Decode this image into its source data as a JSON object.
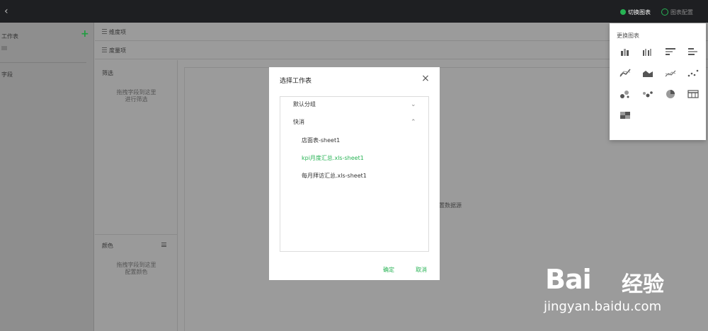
{
  "topbar": {
    "switch_chart_label": "切换图表",
    "chart_config_label": "图表配置"
  },
  "left_panel": {
    "worksheet_title": "工作表",
    "fields_title": "字段"
  },
  "shelves": {
    "dimension_label": "维度项",
    "measure_label": "度量项"
  },
  "filter": {
    "title": "筛选",
    "hint_line1": "拖拽字段到这里",
    "hint_line2": "进行筛选"
  },
  "color": {
    "title": "颜色",
    "hint_line1": "拖拽字段到这里",
    "hint_line2": "配置颜色"
  },
  "canvas": {
    "hint": "配置数据源"
  },
  "popup": {
    "title": "更换图表",
    "chart_types": [
      "grouped-bar-icon",
      "stacked-bar-icon",
      "horizontal-bar-icon",
      "horizontal-stacked-bar-icon",
      "line-icon",
      "area-icon",
      "multi-line-icon",
      "scatter-icon",
      "bubble-icon",
      "dot-icon",
      "pie-icon",
      "table-icon",
      "heatmap-icon"
    ]
  },
  "modal": {
    "title": "选择工作表",
    "groups": [
      {
        "label": "默认分组",
        "expanded": false,
        "items": []
      },
      {
        "label": "快消",
        "expanded": true,
        "items": [
          {
            "label": "店面表-sheet1",
            "active": false
          },
          {
            "label": "kpi月度汇总.xls-sheet1",
            "active": true
          },
          {
            "label": "每月拜访汇总.xls-sheet1",
            "active": false
          }
        ]
      }
    ],
    "ok_label": "确定",
    "cancel_label": "取消"
  },
  "watermark": {
    "brand": "Bai",
    "brand2": "经验",
    "url": "jingyan.baidu.com"
  },
  "colors": {
    "accent": "#27b354",
    "topbar": "#1e1f22",
    "overlay": "#9a9a9a"
  }
}
